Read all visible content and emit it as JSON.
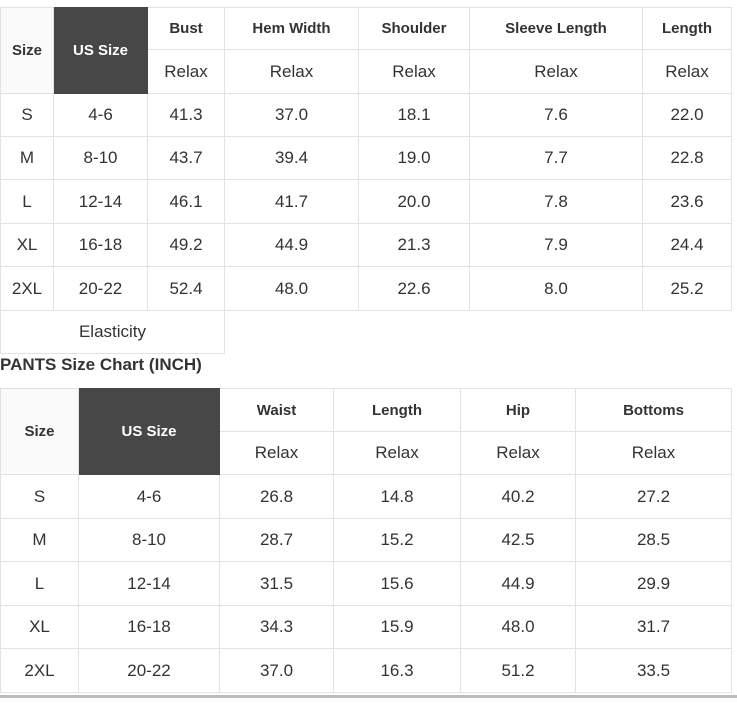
{
  "top_chart": {
    "headers": [
      "Size",
      "US Size",
      "Bust",
      "Hem Width",
      "Shoulder",
      "Sleeve Length",
      "Length"
    ],
    "subheader": [
      "Relax",
      "Relax",
      "Relax",
      "Relax",
      "Relax"
    ],
    "rows": [
      [
        "S",
        "4-6",
        "41.3",
        "37.0",
        "18.1",
        "7.6",
        "22.0"
      ],
      [
        "M",
        "8-10",
        "43.7",
        "39.4",
        "19.0",
        "7.7",
        "22.8"
      ],
      [
        "L",
        "12-14",
        "46.1",
        "41.7",
        "20.0",
        "7.8",
        "23.6"
      ],
      [
        "XL",
        "16-18",
        "49.2",
        "44.9",
        "21.3",
        "7.9",
        "24.4"
      ],
      [
        "2XL",
        "20-22",
        "52.4",
        "48.0",
        "22.6",
        "8.0",
        "25.2"
      ]
    ],
    "elasticity_label": "Elasticity"
  },
  "pants_chart": {
    "title": "PANTS Size Chart (INCH)",
    "headers": [
      "Size",
      "US Size",
      "Waist",
      "Length",
      "Hip",
      "Bottoms"
    ],
    "subheader": [
      "Relax",
      "Relax",
      "Relax",
      "Relax"
    ],
    "rows": [
      [
        "S",
        "4-6",
        "26.8",
        "14.8",
        "40.2",
        "27.2"
      ],
      [
        "M",
        "8-10",
        "28.7",
        "15.2",
        "42.5",
        "28.5"
      ],
      [
        "L",
        "12-14",
        "31.5",
        "15.6",
        "44.9",
        "29.9"
      ],
      [
        "XL",
        "16-18",
        "34.3",
        "15.9",
        "48.0",
        "31.7"
      ],
      [
        "2XL",
        "20-22",
        "37.0",
        "16.3",
        "51.2",
        "33.5"
      ]
    ]
  }
}
